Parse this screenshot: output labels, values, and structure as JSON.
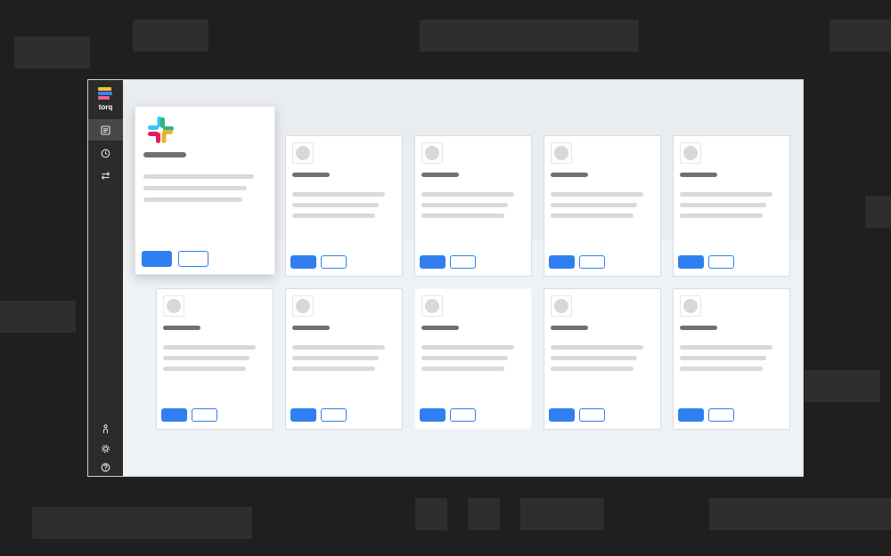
{
  "app": {
    "brand": "torq",
    "brand_colors": [
      "#f4c430",
      "#3b82f6",
      "#ef5d8d"
    ],
    "accent": "#2f7ff0"
  },
  "sidebar": {
    "items": [
      {
        "icon": "document-icon",
        "active": true
      },
      {
        "icon": "clock-icon",
        "active": false
      },
      {
        "icon": "transfer-icon",
        "active": false
      }
    ],
    "bottom_items": [
      {
        "icon": "person-icon"
      },
      {
        "icon": "gear-icon"
      },
      {
        "icon": "help-icon"
      }
    ]
  },
  "cards": {
    "featured": {
      "icon": "slack-logo"
    },
    "placeholder_count": 9
  }
}
